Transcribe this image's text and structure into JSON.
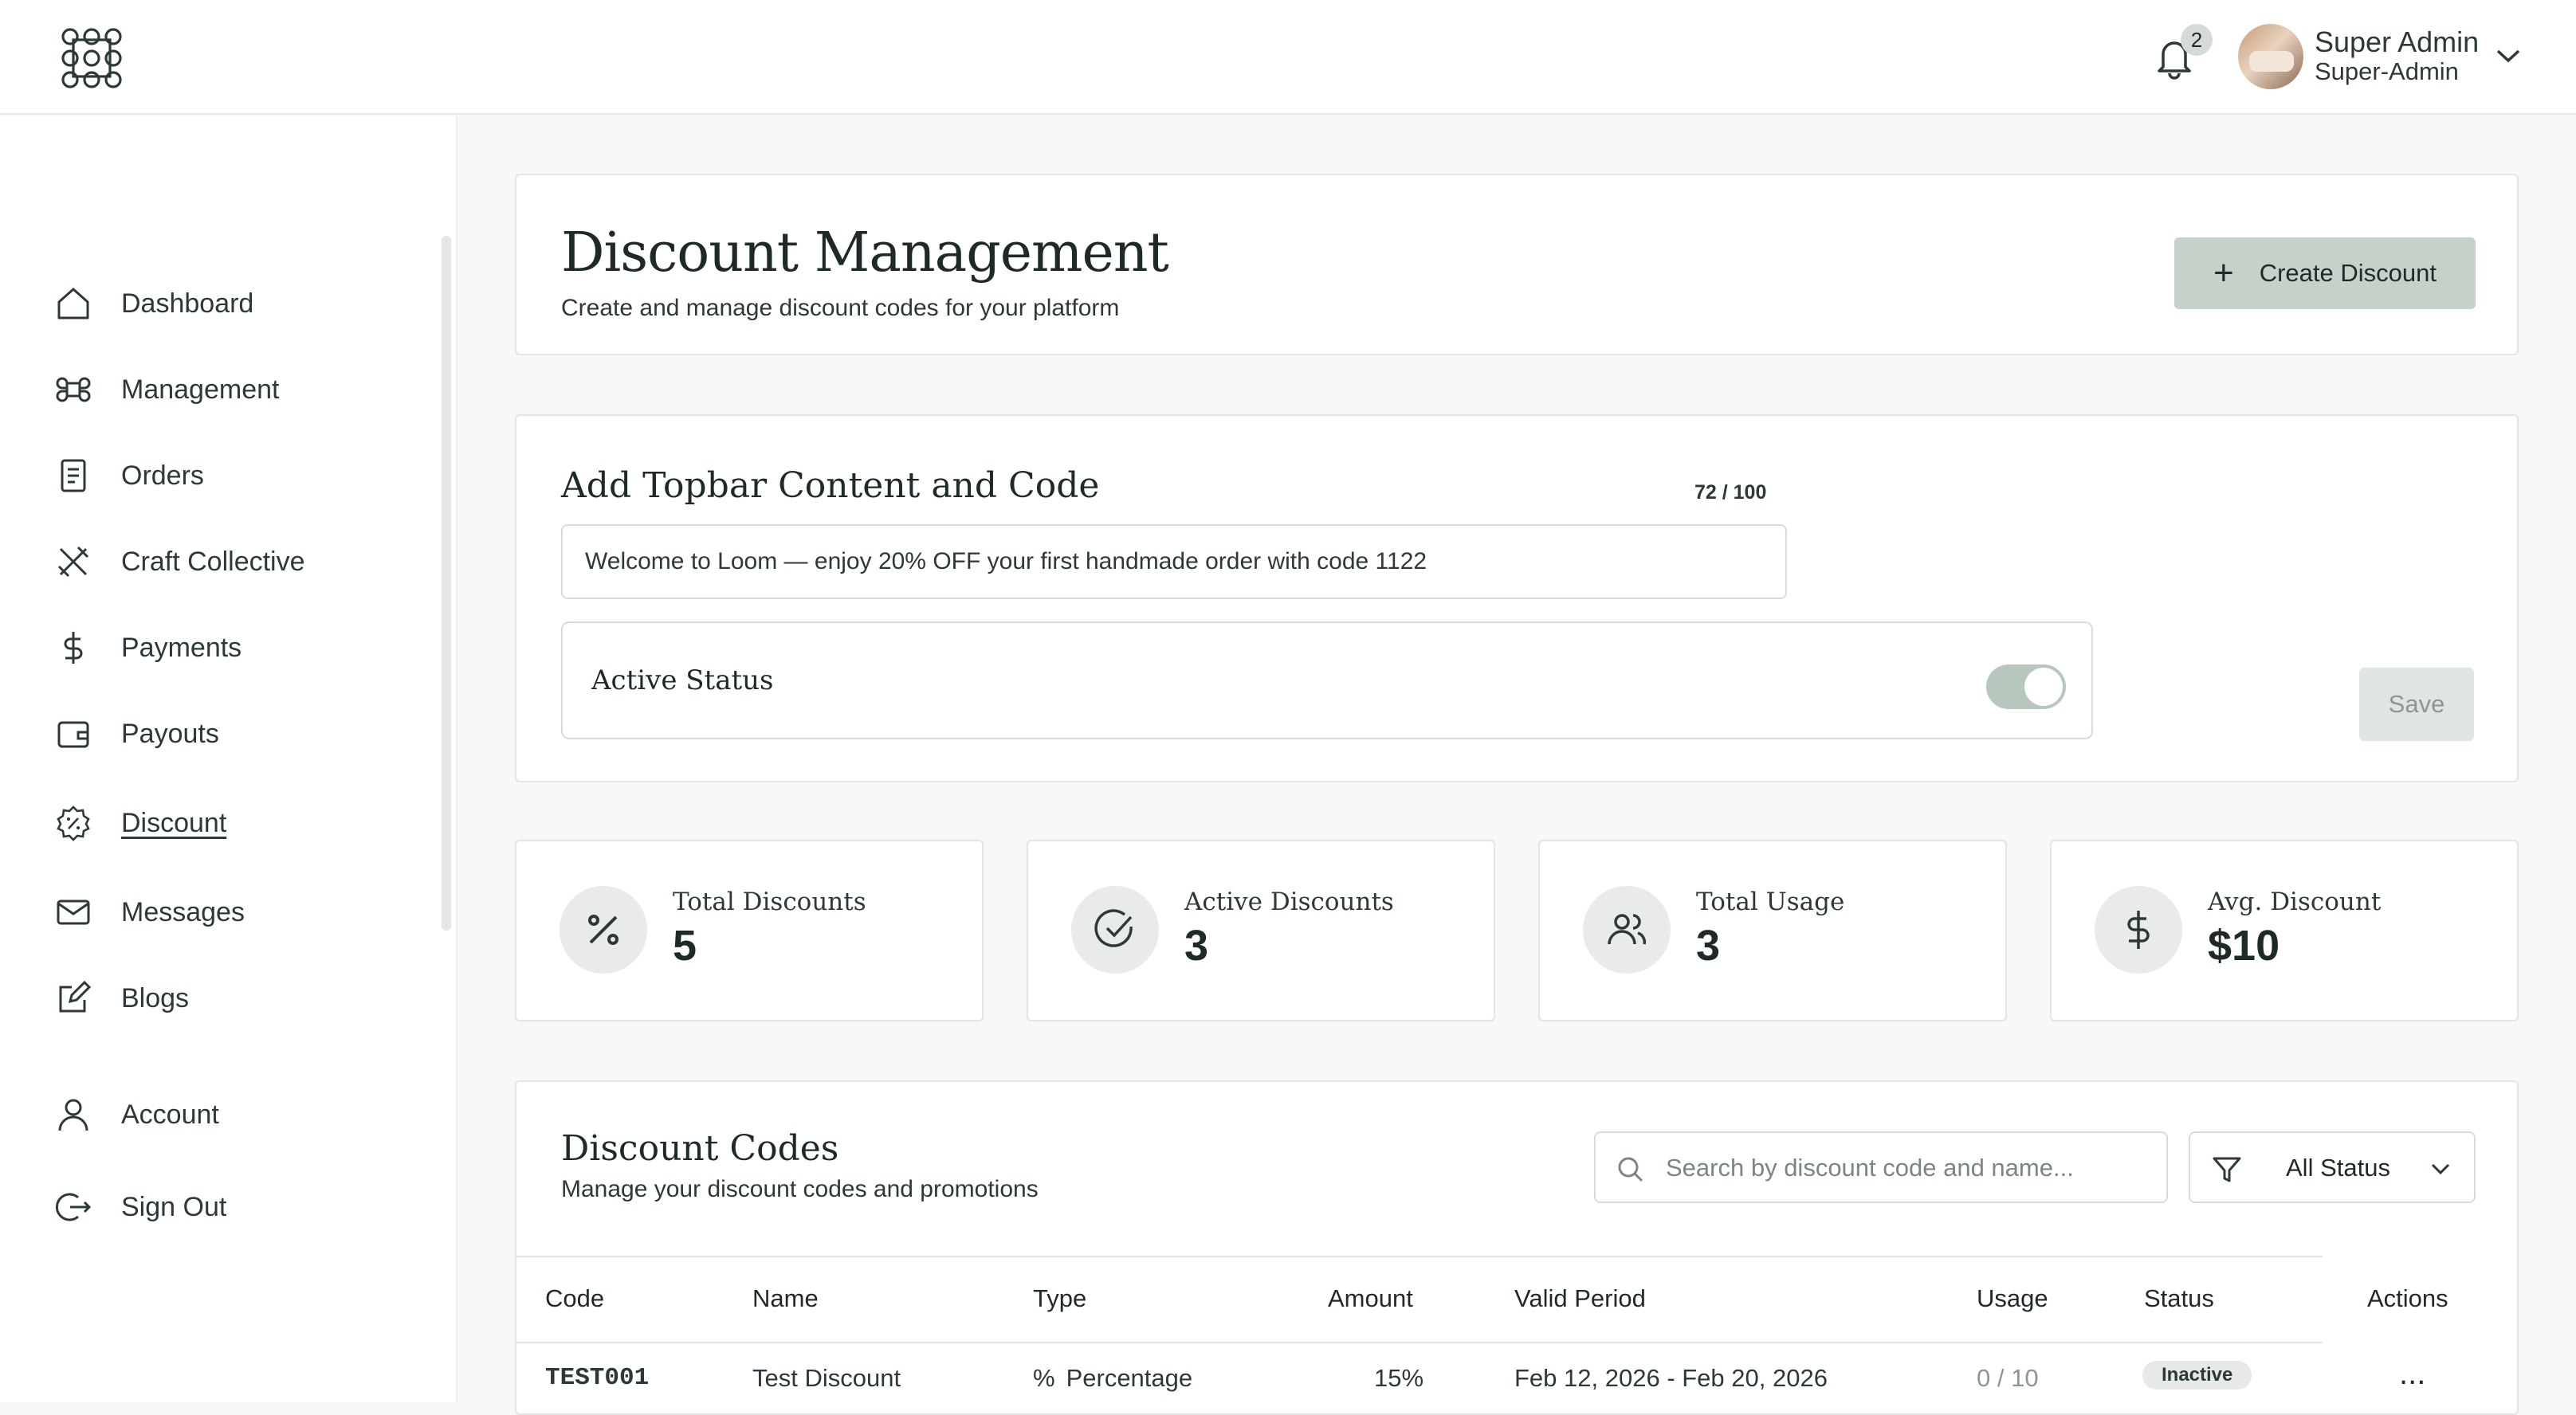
{
  "header": {
    "notifications_count": "2",
    "user_name": "Super Admin",
    "user_role": "Super-Admin",
    "icons": [
      "logo-icon",
      "bell-icon",
      "chevron-down-icon"
    ]
  },
  "sidebar": {
    "items": [
      {
        "label": "Dashboard",
        "icon": "home-icon"
      },
      {
        "label": "Management",
        "icon": "command-icon"
      },
      {
        "label": "Orders",
        "icon": "document-icon"
      },
      {
        "label": "Craft Collective",
        "icon": "craft-tools-icon"
      },
      {
        "label": "Payments",
        "icon": "dollar-icon"
      },
      {
        "label": "Payouts",
        "icon": "wallet-icon"
      },
      {
        "label": "Discount",
        "icon": "discount-badge-icon"
      },
      {
        "label": "Messages",
        "icon": "mail-icon"
      },
      {
        "label": "Blogs",
        "icon": "edit-icon"
      },
      {
        "label": "Account",
        "icon": "user-icon"
      },
      {
        "label": "Sign Out",
        "icon": "sign-out-icon"
      }
    ],
    "active": "Discount"
  },
  "page": {
    "title": "Discount Management",
    "subtitle": "Create and manage discount codes for your platform",
    "create_button": "Create Discount"
  },
  "topbar_content": {
    "title": "Add Topbar Content and Code",
    "counter": "72 / 100",
    "value": "Welcome to Loom — enjoy 20% OFF your first handmade order with code 1122",
    "active_status_label": "Active Status",
    "active": true,
    "save_button": "Save"
  },
  "stats": [
    {
      "label": "Total Discounts",
      "value": "5",
      "icon": "percent-icon"
    },
    {
      "label": "Active Discounts",
      "value": "3",
      "icon": "check-circle-icon"
    },
    {
      "label": "Total Usage",
      "value": "3",
      "icon": "users-icon"
    },
    {
      "label": "Avg. Discount",
      "value": "$10",
      "icon": "dollar-icon"
    }
  ],
  "codes": {
    "title": "Discount Codes",
    "subtitle": "Manage your discount codes and promotions",
    "search_placeholder": "Search by discount code and name...",
    "filter_value": "All Status",
    "columns": [
      "Code",
      "Name",
      "Type",
      "Amount",
      "Valid Period",
      "Usage",
      "Status",
      "Actions"
    ],
    "rows": [
      {
        "code": "TEST001",
        "name": "Test Discount",
        "type": "Percentage",
        "amount": "15%",
        "valid": "Feb 12, 2026 - Feb 20, 2026",
        "usage": "0 / 10",
        "status": "Inactive",
        "actions": "..."
      }
    ]
  },
  "colors": {
    "accent": "#c5d1c9",
    "toggle_on": "#b8c7bd",
    "border": "#e2e5e3",
    "text": "#1f2a24"
  }
}
